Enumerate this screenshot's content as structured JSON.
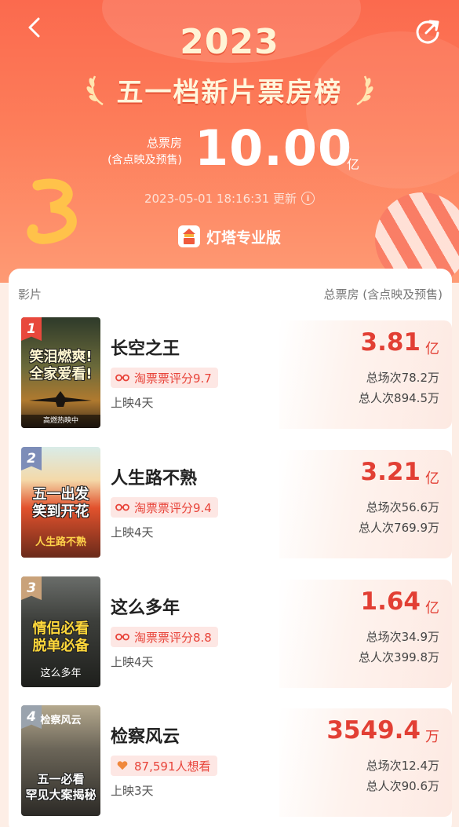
{
  "header": {
    "year": "2023",
    "title": "五一档新片票房榜",
    "total_label": "总票房",
    "total_sub": "(含点映及预售)",
    "total_value": "10.00",
    "total_unit": "亿",
    "updated": "2023-05-01 18:16:31 更新",
    "brand": "灯塔专业版"
  },
  "table": {
    "col_left": "影片",
    "col_right": "总票房 (含点映及预售)"
  },
  "movies": [
    {
      "rank": "1",
      "name": "长空之王",
      "rating": "淘票票评分9.7",
      "days": "上映4天",
      "box": "3.81",
      "box_unit": "亿",
      "shows": "总场次78.2万",
      "people": "总人次894.5万",
      "poster_slogan": "笑泪燃爽!\n全家爱看!",
      "poster_tag": "高燃热映中",
      "rank_color": "#e8483c"
    },
    {
      "rank": "2",
      "name": "人生路不熟",
      "rating": "淘票票评分9.4",
      "days": "上映4天",
      "box": "3.21",
      "box_unit": "亿",
      "shows": "总场次56.6万",
      "people": "总人次769.9万",
      "poster_slogan": "五一出发\n笑到开花",
      "poster_tag": "",
      "rank_color": "#7d8db8"
    },
    {
      "rank": "3",
      "name": "这么多年",
      "rating": "淘票票评分8.8",
      "days": "上映4天",
      "box": "1.64",
      "box_unit": "亿",
      "shows": "总场次34.9万",
      "people": "总人次399.8万",
      "poster_slogan": "情侣必看\n脱单必备",
      "poster_tag": "",
      "rank_color": "#c9a27a"
    },
    {
      "rank": "4",
      "name": "检察风云",
      "rating": "87,591人想看",
      "days": "上映3天",
      "box": "3549.4",
      "box_unit": "万",
      "shows": "总场次12.4万",
      "people": "总人次90.6万",
      "poster_slogan": "五一必看\n罕见大案揭秘",
      "poster_tag": "",
      "rank_color": "#9aa3ad"
    }
  ],
  "colors": {
    "accent": "#e23f34",
    "hero_top": "#fb6a4e",
    "hero_bottom": "#fe9a74"
  }
}
